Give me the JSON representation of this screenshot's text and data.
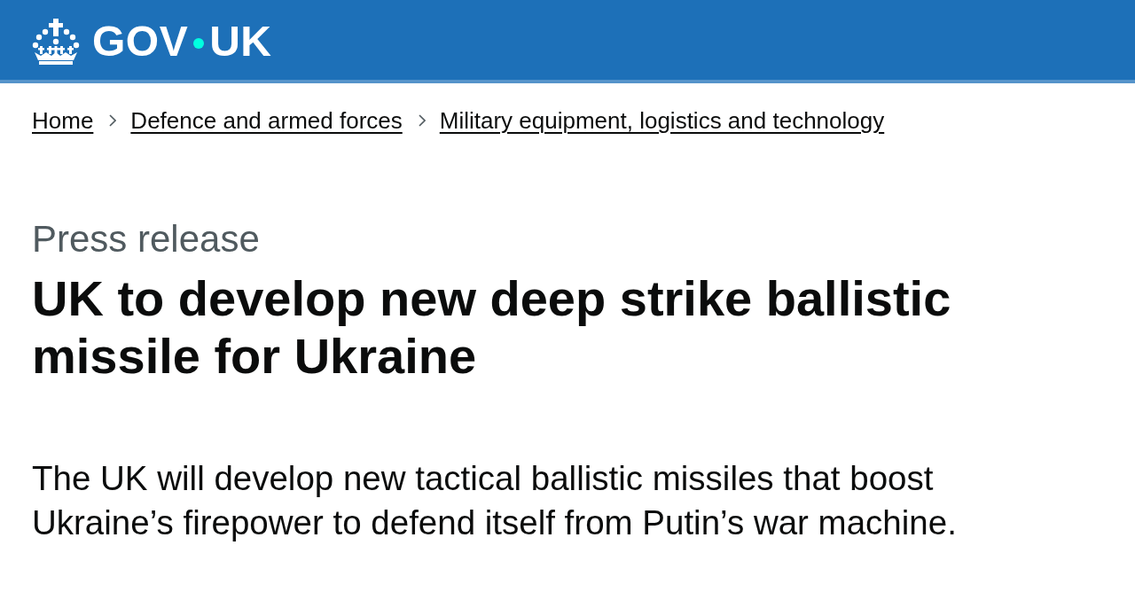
{
  "header": {
    "logo": {
      "left": "GOV",
      "right": "UK"
    }
  },
  "breadcrumbs": [
    "Home",
    "Defence and armed forces",
    "Military equipment, logistics and technology"
  ],
  "caption": "Press release",
  "title": "UK to develop new deep strike ballistic missile for Ukraine",
  "lead": "The UK will develop new tactical ballistic missiles that boost Ukraine’s firepower to defend itself from Putin’s war machine."
}
